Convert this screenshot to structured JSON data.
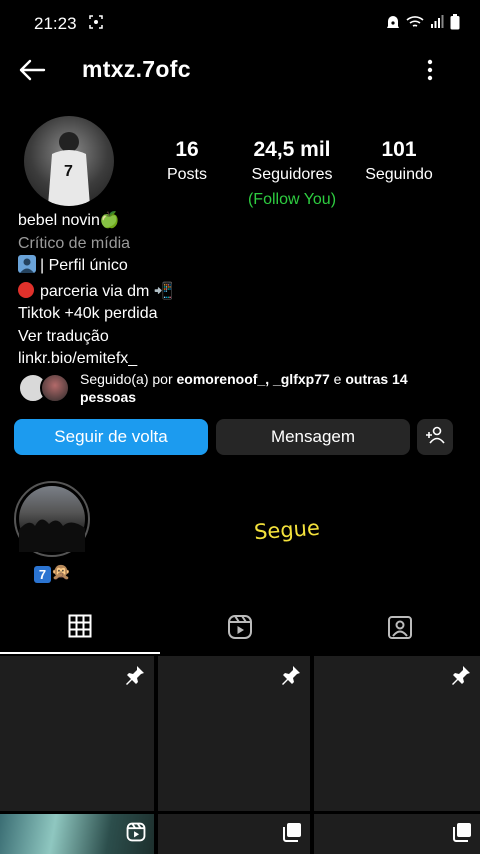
{
  "status_bar": {
    "time": "21:23",
    "icons": [
      "screenshot-icon",
      "alarm-icon",
      "wifi-icon",
      "signal-icon",
      "battery-icon"
    ]
  },
  "header": {
    "username": "mtxz.7ofc",
    "back_icon": "arrow-left-icon",
    "more_icon": "vertical-dots-icon"
  },
  "profile": {
    "stats": [
      {
        "value": "16",
        "label": "Posts"
      },
      {
        "value": "24,5 mil",
        "label": "Seguidores"
      },
      {
        "value": "101",
        "label": "Seguindo"
      }
    ],
    "follow_you": "(Follow You)",
    "name": "bebel novin🍏",
    "category": "Crítico de mídia",
    "bio_line1": "| Perfil único",
    "bio_line2": "parceria via dm 📲",
    "bio_line3": "Tiktok +40k perdida",
    "translate": "Ver tradução",
    "link": "linkr.bio/emitefx_"
  },
  "followed_by": {
    "prefix": "Seguido(a) por",
    "users": "eomorenoof_, _glfxp77",
    "joiner": "e",
    "others": "outras 14 pessoas"
  },
  "actions": {
    "follow_back": "Seguir de volta",
    "message": "Mensagem",
    "add_icon": "add-person-icon"
  },
  "highlights": [
    {
      "label": "🙊"
    }
  ],
  "overlay_text": "Segue",
  "tabs": [
    {
      "icon": "grid-icon",
      "active": true
    },
    {
      "icon": "reels-icon",
      "active": false
    },
    {
      "icon": "tagged-icon",
      "active": false
    }
  ],
  "colors": {
    "accent": "#1c9bef",
    "follow_you": "#2ecc40",
    "secondary_button": "#262626"
  }
}
